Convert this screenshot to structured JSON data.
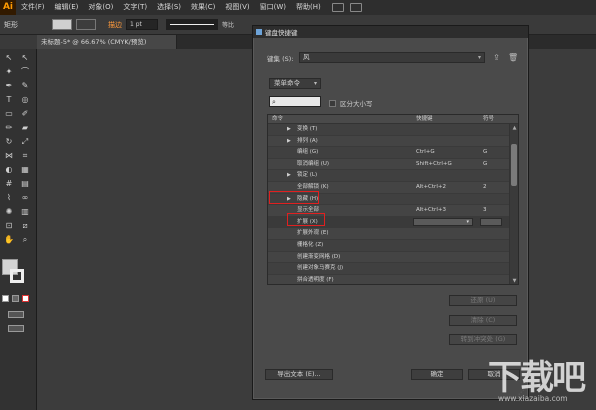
{
  "app": {
    "logo_text": "Ai",
    "menu": [
      "文件(F)",
      "编辑(E)",
      "对象(O)",
      "文字(T)",
      "选择(S)",
      "效果(C)",
      "视图(V)",
      "窗口(W)",
      "帮助(H)"
    ],
    "document_tab": "未标题-5* @ 66.67% (CMYK/预览)"
  },
  "control_bar": {
    "selection_label": "矩形",
    "stroke_label": "描边",
    "stroke_weight": "1 pt",
    "stroke_profile": "等比"
  },
  "dialog": {
    "title": "键盘快捷键",
    "set_label": "键集 (S):",
    "set_value": "风",
    "category_value": "菜单命令",
    "search_placeholder": "",
    "case_label": "区分大小写",
    "columns": {
      "command": "命令",
      "shortcut": "快捷键",
      "symbol": "符号"
    },
    "rows": [
      {
        "name": "变换 (T)",
        "shortcut": "",
        "symbol": "",
        "expandable": true
      },
      {
        "name": "排列 (A)",
        "shortcut": "",
        "symbol": "",
        "expandable": true
      },
      {
        "name": "编组 (G)",
        "shortcut": "Ctrl+G",
        "symbol": "G",
        "expandable": false
      },
      {
        "name": "取消编组 (U)",
        "shortcut": "Shift+Ctrl+G",
        "symbol": "G",
        "expandable": false
      },
      {
        "name": "锁定 (L)",
        "shortcut": "",
        "symbol": "",
        "expandable": true
      },
      {
        "name": "全部解锁 (K)",
        "shortcut": "Alt+Ctrl+2",
        "symbol": "2",
        "expandable": false
      },
      {
        "name": "隐藏 (H)",
        "shortcut": "",
        "symbol": "",
        "expandable": true
      },
      {
        "name": "显示全部",
        "shortcut": "Alt+Ctrl+3",
        "symbol": "3",
        "expandable": false
      },
      {
        "name": "扩展 (X)",
        "shortcut": "",
        "symbol": "",
        "expandable": false,
        "editing": true
      },
      {
        "name": "扩展外观 (E)",
        "shortcut": "",
        "symbol": "",
        "expandable": false
      },
      {
        "name": "栅格化 (Z)",
        "shortcut": "",
        "symbol": "",
        "expandable": false
      },
      {
        "name": "创建渐变网格 (D)",
        "shortcut": "",
        "symbol": "",
        "expandable": false
      },
      {
        "name": "创建对象马赛克 (J)",
        "shortcut": "",
        "symbol": "",
        "expandable": false
      },
      {
        "name": "拼合透明度 (F)",
        "shortcut": "",
        "symbol": "",
        "expandable": false
      }
    ],
    "buttons": {
      "restore": "还原 (U)",
      "clear": "清除 (C)",
      "goto_conflict": "转到冲突处 (G)",
      "export_text": "导出文本 (E)...",
      "ok": "确定",
      "cancel": "取消"
    }
  },
  "watermark": {
    "text": "下载吧",
    "url": "www.xiazaiba.com"
  },
  "colors": {
    "highlight": "#e02020",
    "ai_orange": "#ff9a00"
  }
}
